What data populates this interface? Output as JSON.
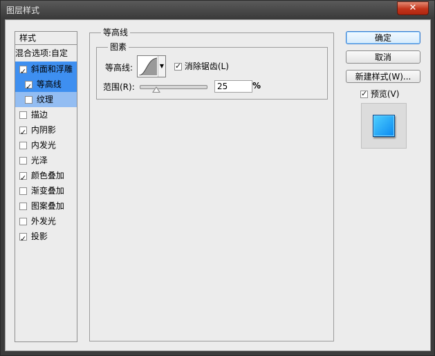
{
  "window": {
    "title": "图层样式",
    "close_label": "✕"
  },
  "left_panel": {
    "header": "样式",
    "items": [
      {
        "label": "混合选项:自定",
        "has_checkbox": false,
        "checked": false,
        "state": "normal"
      },
      {
        "label": "斜面和浮雕",
        "has_checkbox": true,
        "checked": true,
        "state": "selected"
      },
      {
        "label": "等高线",
        "has_checkbox": true,
        "checked": true,
        "state": "selected-sub"
      },
      {
        "label": "纹理",
        "has_checkbox": true,
        "checked": false,
        "state": "pale-sub"
      },
      {
        "label": "描边",
        "has_checkbox": true,
        "checked": false,
        "state": "normal"
      },
      {
        "label": "内阴影",
        "has_checkbox": true,
        "checked": true,
        "state": "normal"
      },
      {
        "label": "内发光",
        "has_checkbox": true,
        "checked": false,
        "state": "normal"
      },
      {
        "label": "光泽",
        "has_checkbox": true,
        "checked": false,
        "state": "normal"
      },
      {
        "label": "颜色叠加",
        "has_checkbox": true,
        "checked": true,
        "state": "normal"
      },
      {
        "label": "渐变叠加",
        "has_checkbox": true,
        "checked": false,
        "state": "normal"
      },
      {
        "label": "图案叠加",
        "has_checkbox": true,
        "checked": false,
        "state": "normal"
      },
      {
        "label": "外发光",
        "has_checkbox": true,
        "checked": false,
        "state": "normal"
      },
      {
        "label": "投影",
        "has_checkbox": true,
        "checked": true,
        "state": "normal"
      }
    ]
  },
  "contour_section": {
    "title": "等高线",
    "elements_title": "图素",
    "contour_label": "等高线:",
    "anti_alias_label": "消除锯齿(L)",
    "anti_alias_checked": true,
    "range_label": "范围(R):",
    "range_value": "25",
    "range_unit": "%",
    "range_fraction": 0.25
  },
  "buttons": {
    "ok": "确定",
    "cancel": "取消",
    "new_style": "新建样式(W)...",
    "preview_label": "预览(V)",
    "preview_checked": true
  },
  "colors": {
    "selection": "#3e8ff0",
    "preview_swatch": "#1aa4ff"
  }
}
